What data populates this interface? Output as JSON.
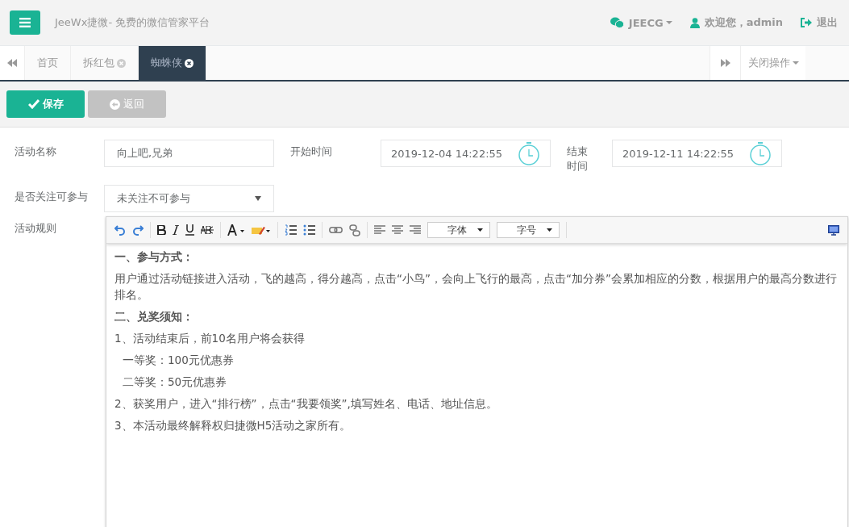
{
  "header": {
    "title": "JeeWx捷微- 免费的微信管家平台",
    "account": "JEECG",
    "welcome": "欢迎您，admin",
    "logout": "退出"
  },
  "tabs": [
    {
      "label": "首页",
      "closable": false,
      "selected": false
    },
    {
      "label": "拆红包",
      "closable": true,
      "selected": false
    },
    {
      "label": "蜘蛛侠",
      "closable": true,
      "selected": true
    }
  ],
  "tab_menu": "关闭操作",
  "actions": [
    {
      "label": "保存",
      "kind": "primary"
    },
    {
      "label": "返回",
      "kind": "back"
    }
  ],
  "form": {
    "name_label": "活动名称",
    "name_value": "向上吧,兄弟",
    "start_label": "开始时间",
    "start_value": "2019-12-04 14:22:55",
    "end_label": "结束时间",
    "end_value": "2019-12-11 14:22:55",
    "follow_label": "是否关注可参与",
    "follow_value": "未关注不可参与",
    "rules_label": "活动规则"
  },
  "editor": {
    "font_select": "字体",
    "size_select": "字号",
    "paragraphs": [
      {
        "text": "一、参与方式：",
        "kind": "heading"
      },
      {
        "text": "用户通过活动链接进入活动，飞的越高，得分越高，点击“小鸟”，会向上飞行的最高，点击“加分券”会累加相应的分数，根据用户的最高分数进行排名。",
        "kind": "text"
      },
      {
        "text": "二、兑奖须知：",
        "kind": "heading"
      },
      {
        "text": "1、活动结束后，前10名用户将会获得",
        "kind": "text"
      },
      {
        "text": "一等奖：100元优惠券",
        "kind": "indent"
      },
      {
        "text": "二等奖：50元优惠券",
        "kind": "indent"
      },
      {
        "text": "2、获奖用户，进入“排行榜”，点击“我要领奖”,填写姓名、电话、地址信息。",
        "kind": "text"
      },
      {
        "text": "3、本活动最终解释权归捷微H5活动之家所有。",
        "kind": "text"
      }
    ]
  }
}
